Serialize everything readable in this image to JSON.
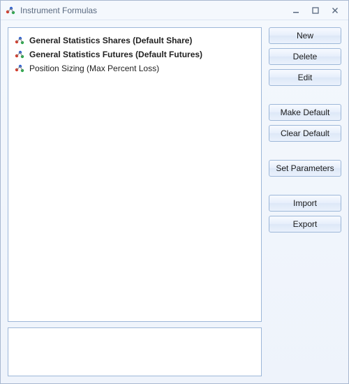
{
  "window": {
    "title": "Instrument Formulas"
  },
  "list": {
    "items": [
      {
        "label": "General Statistics Shares (Default Share)",
        "bold": true
      },
      {
        "label": "General Statistics Futures (Default Futures)",
        "bold": true
      },
      {
        "label": "Position Sizing (Max Percent Loss)",
        "bold": false
      }
    ]
  },
  "buttons": {
    "new_": "New",
    "delete_": "Delete",
    "edit": "Edit",
    "make_default": "Make Default",
    "clear_default": "Clear Default",
    "set_parameters": "Set Parameters",
    "import_": "Import",
    "export_": "Export"
  },
  "description": ""
}
